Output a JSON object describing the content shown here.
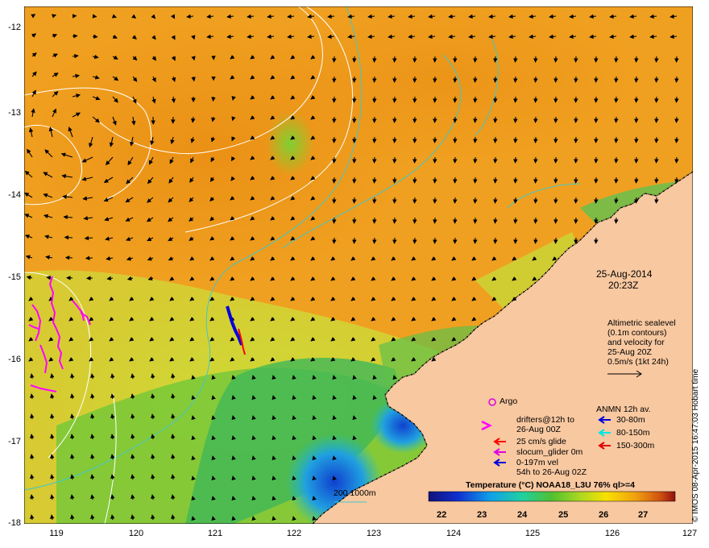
{
  "map": {
    "date": "25-Aug-2014",
    "time": "20:23Z",
    "y_axis_labels": [
      "-12",
      "-13",
      "-14",
      "-15",
      "-16",
      "-17",
      "-18"
    ],
    "x_axis_labels": [
      "119",
      "120",
      "121",
      "122",
      "123",
      "124",
      "125",
      "126",
      "127"
    ],
    "altimetric_note": [
      "Altimetric sealevel",
      "(0.1m contours)",
      "and velocity for",
      "25-Aug 20Z",
      "0.5m/s (1kt 24h)"
    ],
    "legend": {
      "argo": "Argo",
      "drifters": [
        "drifters@12h to",
        "26-Aug 00Z"
      ],
      "glide": "25 cm/s glide",
      "slocum": "slocum_glider 0m",
      "vel": [
        "0-197m vel",
        "54h to 26-Aug 02Z"
      ],
      "anmn_title": "ANMN 12h av.",
      "anmn_items": [
        "30-80m",
        "80-150m",
        "150-300m"
      ],
      "anmn_colors": [
        "#0000dd",
        "#00e5e5",
        "#e00000"
      ]
    },
    "colorbar": {
      "title": "Temperature (°C) NOAA18_L3U 76% ql>=4",
      "ticks": [
        "22",
        "23",
        "24",
        "25",
        "26",
        "27"
      ]
    },
    "contour_label": "200  1000m",
    "credit": "© IMOS 08-Apr-2015 16:47:03 Hobart time",
    "colors": {
      "land": "#f8c8a0",
      "warm_sea": "#f0a020",
      "bathymetry": "#40c8c8",
      "argo": "#e000e0",
      "drifter": "#ff00ff",
      "glide": "#ff0000"
    }
  }
}
